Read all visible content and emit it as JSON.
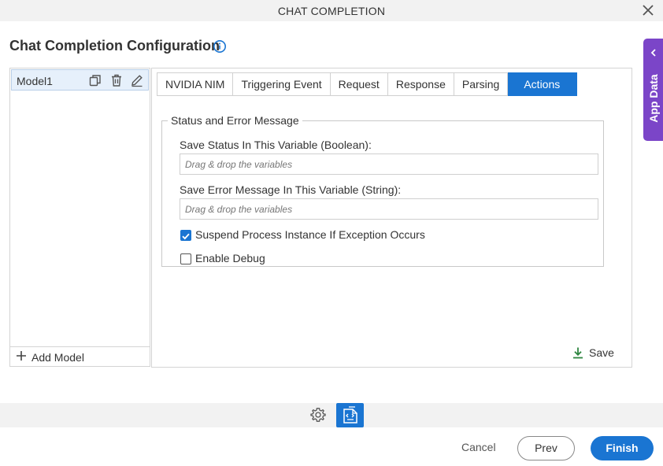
{
  "window": {
    "title": "CHAT COMPLETION"
  },
  "page": {
    "heading": "Chat Completion Configuration"
  },
  "models": {
    "items": [
      {
        "label": "Model1"
      }
    ],
    "add_label": "Add Model"
  },
  "tabs": [
    {
      "label": "NVIDIA NIM",
      "active": false
    },
    {
      "label": "Triggering Event",
      "active": false
    },
    {
      "label": "Request",
      "active": false
    },
    {
      "label": "Response",
      "active": false
    },
    {
      "label": "Parsing",
      "active": false
    },
    {
      "label": "Actions",
      "active": true
    }
  ],
  "actions": {
    "group_legend": "Status and Error Message",
    "status_label": "Save Status In This Variable (Boolean):",
    "status_placeholder": "Drag & drop the variables",
    "error_label": "Save Error Message In This Variable (String):",
    "error_placeholder": "Drag & drop the variables",
    "suspend_label": "Suspend Process Instance If Exception Occurs",
    "suspend_checked": true,
    "debug_label": "Enable Debug",
    "debug_checked": false,
    "save_label": "Save"
  },
  "side_tab": {
    "label": "App Data"
  },
  "footer": {
    "cancel_label": "Cancel",
    "prev_label": "Prev",
    "finish_label": "Finish"
  },
  "colors": {
    "accent": "#1a75d2",
    "side_tab": "#7b45c8",
    "save_icon": "#2e8540"
  }
}
